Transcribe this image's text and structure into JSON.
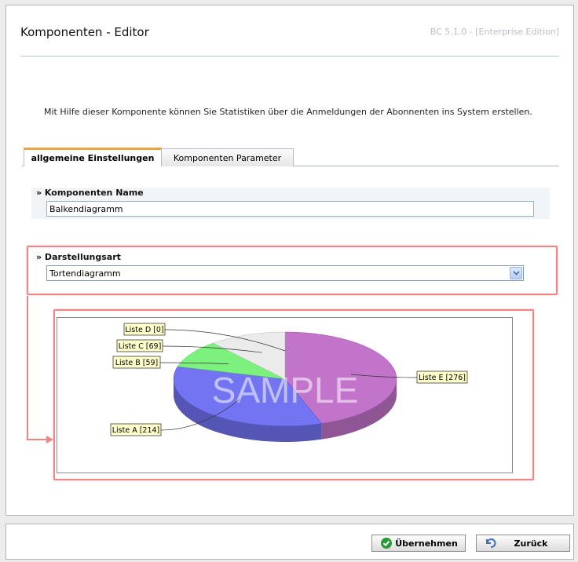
{
  "header": {
    "title": "Komponenten - Editor",
    "version": "BC 5.1.0 - [Enterprise Edition]"
  },
  "intro_text": "Mit Hilfe dieser Komponente können Sie Statistiken über die Anmeldungen der Abonnenten ins System erstellen.",
  "tabs": [
    {
      "label": "allgemeine Einstellungen",
      "active": true
    },
    {
      "label": "Komponenten Parameter",
      "active": false
    }
  ],
  "fields": {
    "name": {
      "label": "» Komponenten Name",
      "value": "Balkendiagramm"
    },
    "type": {
      "label": "» Darstellungsart",
      "value": "Tortendiagramm"
    }
  },
  "chart_data": {
    "type": "pie",
    "categories": [
      "Liste E",
      "Liste A",
      "Liste B",
      "Liste C",
      "Liste D"
    ],
    "values": [
      276,
      214,
      59,
      69,
      0
    ],
    "labels": [
      "Liste E [276]",
      "Liste A [214]",
      "Liste B [59]",
      "Liste C [69]",
      "Liste D [0]"
    ],
    "colors": [
      "#b65cc0",
      "#5a5cf0",
      "#66ee66",
      "#e8e8e8",
      "#ff5a5a"
    ],
    "watermark": "SAMPLE"
  },
  "footer": {
    "apply_label": "Übernehmen",
    "back_label": "Zurück"
  },
  "colors": {
    "highlight": "#ef8585",
    "tab_accent": "#f0a53c",
    "apply_icon": "#2a9a3a",
    "back_icon": "#3d6fc4"
  }
}
